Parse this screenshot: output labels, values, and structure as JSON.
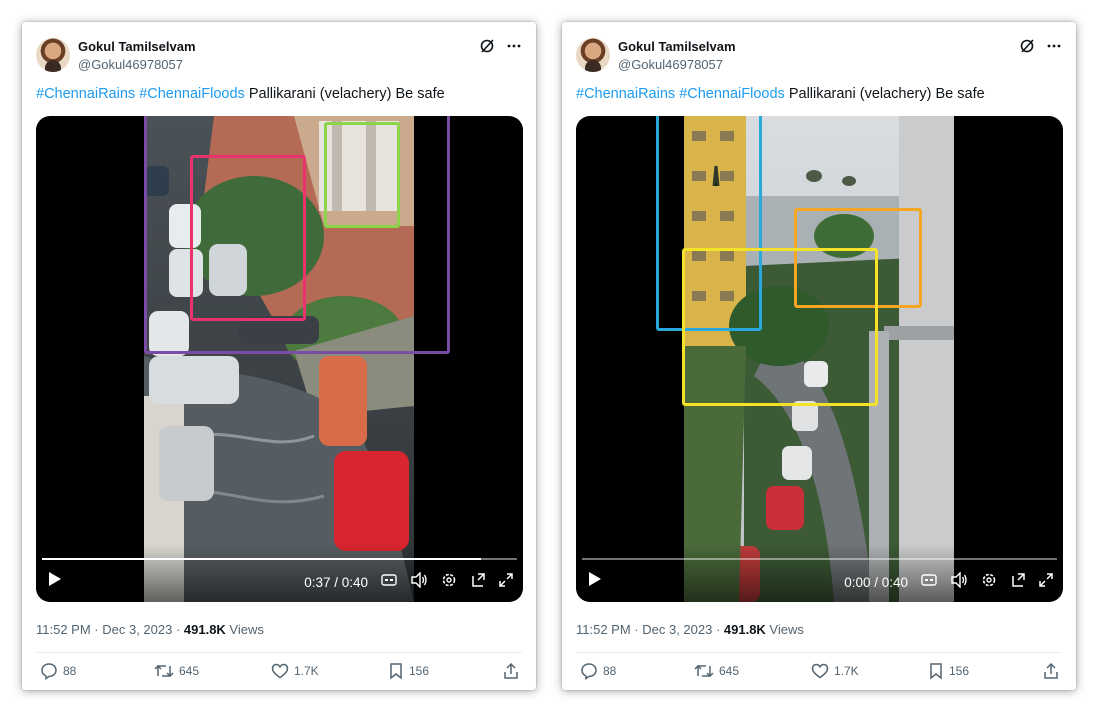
{
  "colors": {
    "hashtag": "#1d9bf0",
    "purple_box": "#7b4ba8",
    "pink_box": "#e8336d",
    "green_box": "#8cd448",
    "blue_box": "#2aa8dc",
    "orange_box": "#f5a623",
    "yellow_box": "#f3e227"
  },
  "icons": {
    "more": "more-horizontal-icon",
    "grok": "grok-icon",
    "play": "play-icon",
    "captions": "captions-icon",
    "volume": "volume-icon",
    "settings": "gear-icon",
    "popout": "popout-icon",
    "fullscreen": "fullscreen-icon",
    "reply": "reply-icon",
    "retweet": "retweet-icon",
    "like": "heart-icon",
    "bookmark": "bookmark-icon",
    "share": "share-icon"
  },
  "posts": [
    {
      "display_name": "Gokul Tamilselvam",
      "handle": "@Gokul46978057",
      "tweet": {
        "tag1": "#ChennaiRains",
        "tag2": "#ChennaiFloods",
        "rest": "Pallikarani (velachery) Be safe"
      },
      "video": {
        "time": "0:37 / 0:40",
        "progress": 0.925
      },
      "posted": "11:52 PM · Dec 3, 2023 · ",
      "views_count": "491.8K",
      "views_label": " Views",
      "stats": {
        "replies": "88",
        "retweets": "645",
        "likes": "1.7K",
        "bookmarks": "156"
      }
    },
    {
      "display_name": "Gokul Tamilselvam",
      "handle": "@Gokul46978057",
      "tweet": {
        "tag1": "#ChennaiRains",
        "tag2": "#ChennaiFloods",
        "rest": "Pallikarani (velachery) Be safe"
      },
      "video": {
        "time": "0:00 / 0:40",
        "progress": 0.0
      },
      "posted": "11:52 PM · Dec 3, 2023 · ",
      "views_count": "491.8K",
      "views_label": " Views",
      "stats": {
        "replies": "88",
        "retweets": "645",
        "likes": "1.7K",
        "bookmarks": "156"
      }
    }
  ]
}
